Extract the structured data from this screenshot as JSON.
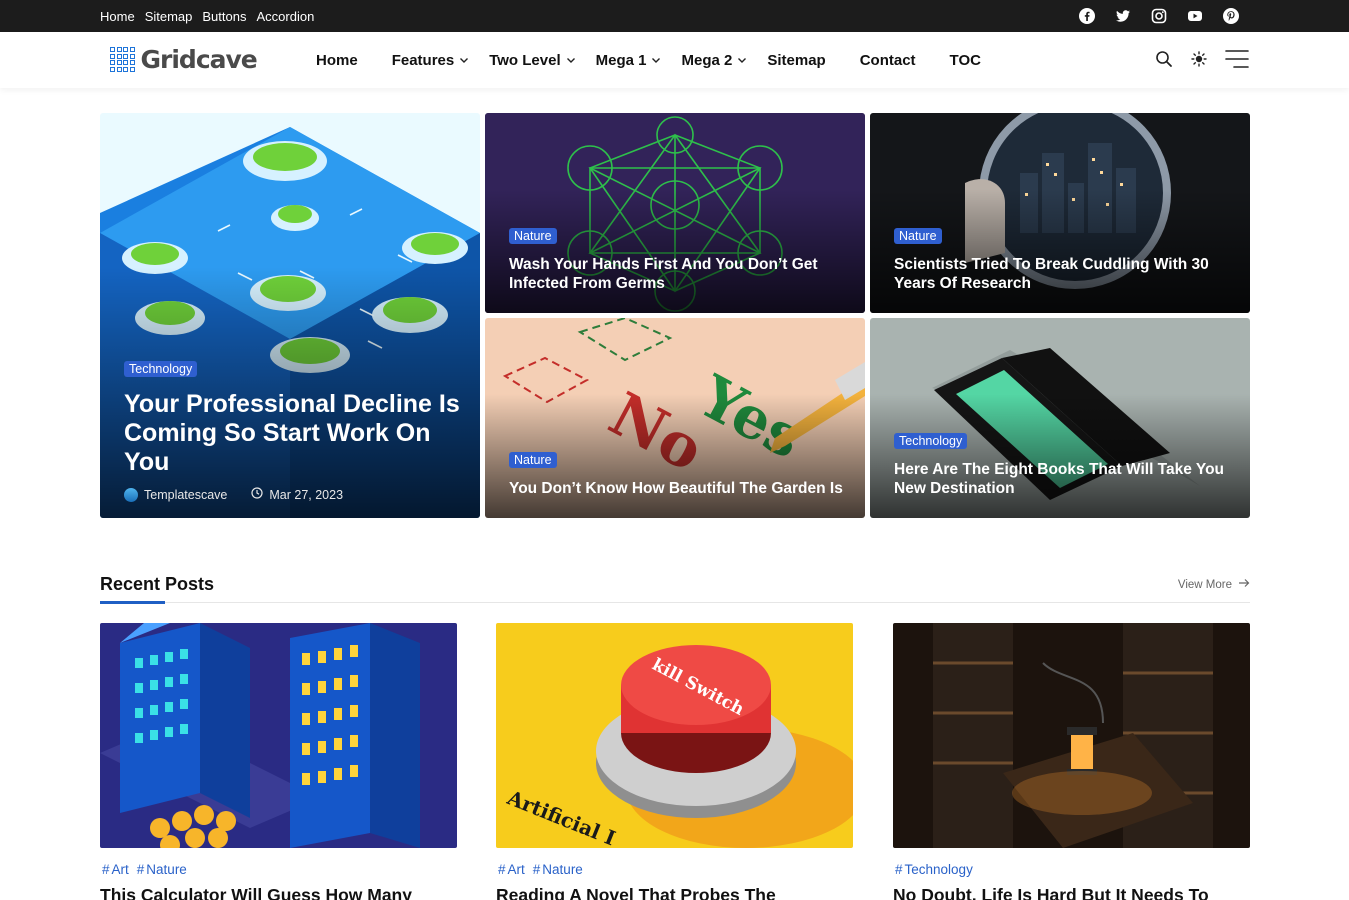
{
  "topbar": {
    "links": [
      "Home",
      "Sitemap",
      "Buttons",
      "Accordion"
    ],
    "social": [
      "facebook-icon",
      "twitter-icon",
      "instagram-icon",
      "youtube-icon",
      "pinterest-icon"
    ]
  },
  "header": {
    "logo_text": "Gridcave",
    "nav": [
      {
        "label": "Home",
        "dropdown": false
      },
      {
        "label": "Features",
        "dropdown": true
      },
      {
        "label": "Two Level",
        "dropdown": true
      },
      {
        "label": "Mega 1",
        "dropdown": true
      },
      {
        "label": "Mega 2",
        "dropdown": true
      },
      {
        "label": "Sitemap",
        "dropdown": false
      },
      {
        "label": "Contact",
        "dropdown": false
      },
      {
        "label": "TOC",
        "dropdown": false
      }
    ],
    "icons": [
      "search-icon",
      "sun-icon",
      "menu-icon"
    ]
  },
  "hero": {
    "main": {
      "category": "Technology",
      "title": "Your Professional Decline Is Coming So Start Work On You",
      "author": "Templatescave",
      "date": "Mar 27, 2023"
    },
    "cards": [
      {
        "category": "Nature",
        "title": "Wash Your Hands First And You Don’t Get Infected From Germs"
      },
      {
        "category": "Nature",
        "title": "Scientists Tried To Break Cuddling With 30 Years Of Research"
      },
      {
        "category": "Nature",
        "title": "You Don’t Know How Beautiful The Garden Is"
      },
      {
        "category": "Technology",
        "title": "Here Are The Eight Books That Will Take You New Destination"
      }
    ]
  },
  "recent": {
    "title": "Recent Posts",
    "view_more": "View More",
    "posts": [
      {
        "tags": [
          "Art",
          "Nature"
        ],
        "title": "This Calculator Will Guess How Many"
      },
      {
        "tags": [
          "Art",
          "Nature"
        ],
        "title": "Reading A Novel That Probes The"
      },
      {
        "tags": [
          "Technology"
        ],
        "title": "No Doubt, Life Is Hard But It Needs To"
      }
    ],
    "post_image_text": {
      "button_label": "kill Switch",
      "book_label": "Artificial I"
    }
  },
  "hero_image_text": {
    "yes": "Yes",
    "no": "No"
  },
  "colors": {
    "accent": "#2f5fd0",
    "topbar": "#1c1c1c",
    "tag": "#2a62c9"
  }
}
